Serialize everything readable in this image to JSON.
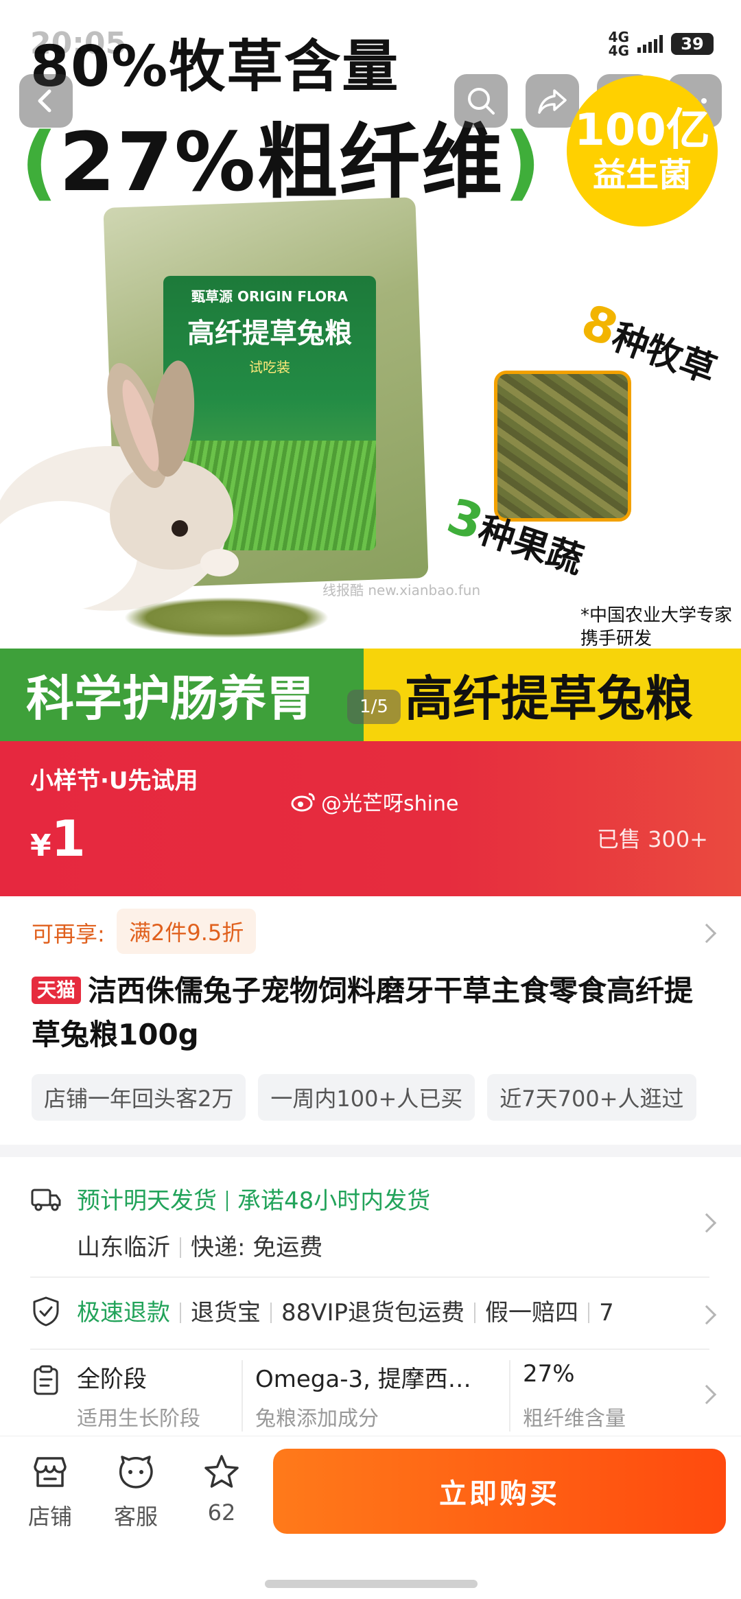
{
  "status_bar": {
    "time": "20:05",
    "network": "4G",
    "battery": "39"
  },
  "hero": {
    "headline_line1": "80%牧草含量",
    "headline_line2": "27%粗纤维",
    "probiotic_line1": "100亿",
    "probiotic_line2": "益生菌",
    "bag_brand": "甄草源 ORIGIN FLORA",
    "bag_title": "高纤提草兔粮",
    "bag_trial": "试吃装",
    "grass_num": "8",
    "grass_text": "种牧草",
    "fruit_num": "3",
    "fruit_text": "种果蔬",
    "research_note_1": "*中国农业大学专家",
    "research_note_2": "携手研发",
    "watermark": "线报酷 new.xianbao.fun",
    "banner_left": "科学护肠养胃",
    "banner_right": "高纤提草兔粮",
    "page_indicator": "1/5"
  },
  "price_banner": {
    "promo_tag": "小样节·U先试用",
    "currency": "¥",
    "price": "1",
    "weibo_handle": "@光芒呀shine",
    "sold": "已售 300+"
  },
  "discount": {
    "label": "可再享:",
    "chip": "满2件9.5折"
  },
  "product": {
    "store_badge": "天猫",
    "title": "洁西侏儒兔子宠物饲料磨牙干草主食零食高纤提草兔粮100g"
  },
  "tags": [
    "店铺一年回头客2万",
    "一周内100+人已买",
    "近7天700+人逛过"
  ],
  "shipping": {
    "estimate": "预计明天发货",
    "promise": "承诺48小时内发货",
    "origin": "山东临沂",
    "express_label": "快递:",
    "express_fee": "免运费"
  },
  "returns": {
    "fast_refund": "极速退款",
    "items": [
      "退货宝",
      "88VIP退货包运费",
      "假一赔四",
      "7"
    ]
  },
  "attributes": [
    {
      "value": "全阶段",
      "key": "适用生长阶段"
    },
    {
      "value": "Omega-3, 提摩西…",
      "key": "兔粮添加成分"
    },
    {
      "value": "27%",
      "key": "粗纤维含量"
    }
  ],
  "bottom_bar": {
    "shop_label": "店铺",
    "service_label": "客服",
    "favorite_count": "62",
    "buy_label": "立即购买"
  },
  "colors": {
    "accent_red": "#e62c3e",
    "buy_orange": "#ff5a14",
    "green": "#22a35a",
    "banner_green": "#3ea03a",
    "banner_yellow": "#f7d40a"
  }
}
